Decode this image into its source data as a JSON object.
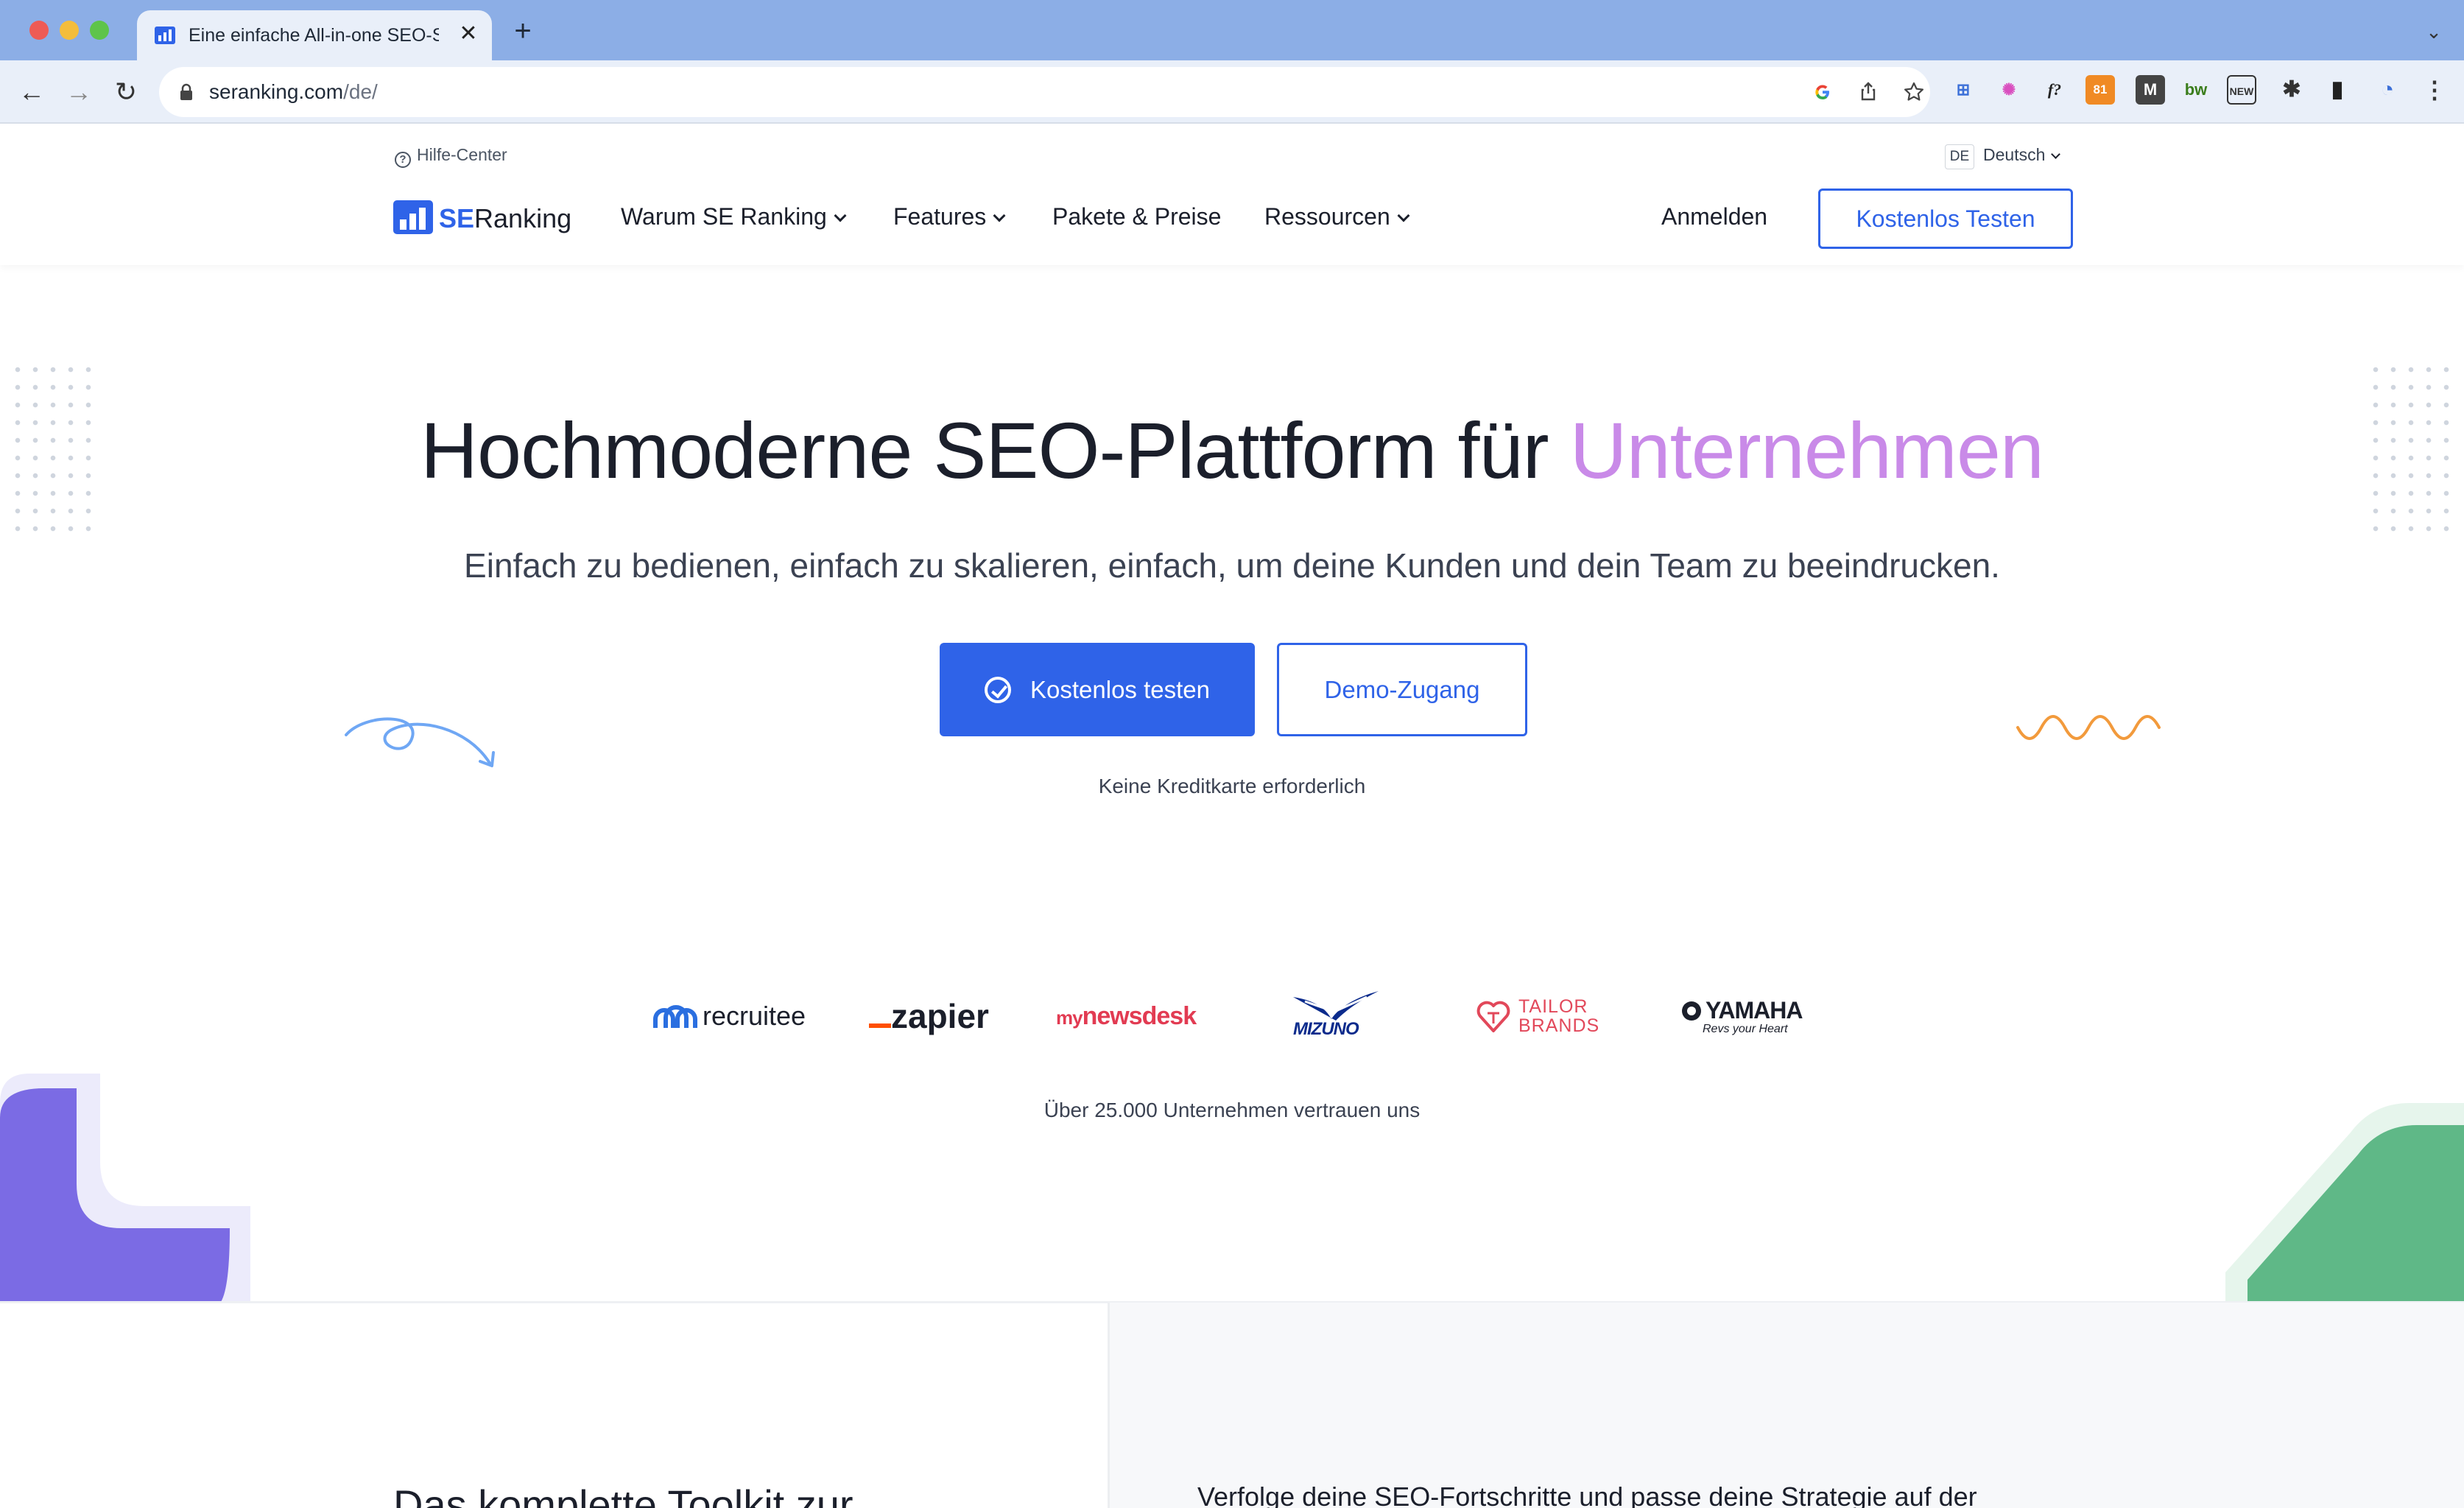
{
  "browser": {
    "tab_title": "Eine einfache All-in-one SEO-Software",
    "tab_close": "✕",
    "new_tab": "+",
    "tab_menu": "⌄",
    "back": "←",
    "forward": "→",
    "reload": "↻",
    "url_host": "seranking.com",
    "url_path": "/de/",
    "omnibox_icons": [
      "google-icon",
      "share-icon",
      "star-icon"
    ],
    "extensions": [
      {
        "name": "ext-translate-icon",
        "label": "⊞",
        "color": "#3b6fd8"
      },
      {
        "name": "ext-color-wheel-icon",
        "label": "✺",
        "color": "#d94fbf"
      },
      {
        "name": "ext-formula-icon",
        "label": "f?",
        "color": "#222222"
      },
      {
        "name": "ext-ahrefs-icon",
        "label": "81",
        "color": "#f08a24"
      },
      {
        "name": "ext-m-icon",
        "label": "M",
        "color": "#333333"
      },
      {
        "name": "ext-bw-icon",
        "label": "bw",
        "color": "#3a7d1c"
      },
      {
        "name": "ext-new-icon",
        "label": "NEW",
        "color": "#333333"
      },
      {
        "name": "extensions-puzzle-icon",
        "label": "✱",
        "color": "#333333"
      },
      {
        "name": "sidepanel-icon",
        "label": "▮",
        "color": "#222222"
      },
      {
        "name": "ext-analytics-icon",
        "label": "◔",
        "color": "#3b6fd8"
      },
      {
        "name": "browser-menu-icon",
        "label": "⋮",
        "color": "#333333"
      }
    ]
  },
  "header": {
    "help": "Hilfe-Center",
    "lang_code": "DE",
    "lang_name": "Deutsch",
    "logo_se": "SE",
    "logo_rest": "Ranking",
    "nav": {
      "why": "Warum SE Ranking",
      "features": "Features",
      "pricing": "Pakete & Preise",
      "resources": "Ressourcen"
    },
    "login": "Anmelden",
    "cta": "Kostenlos Testen"
  },
  "hero": {
    "title_main": "Hochmoderne SEO-Plattform für ",
    "title_accent": "Unternehmen",
    "subtitle": "Einfach zu bedienen, einfach zu skalieren, einfach, um deine Kunden und dein Team zu beeindrucken.",
    "primary_cta": "Kostenlos testen",
    "secondary_cta": "Demo-Zugang",
    "note": "Keine Kreditkarte erforderlich"
  },
  "brands": {
    "recruitee": "recruitee",
    "zapier": "zapier",
    "mynewsdesk_my": "my",
    "mynewsdesk_rest": "newsdesk",
    "mizuno": "MIZUNO",
    "tailor_line1": "TAILOR",
    "tailor_line2": "BRANDS",
    "yamaha": "YAMAHA",
    "yamaha_tag": "Revs your Heart",
    "trust": "Über 25.000 Unternehmen vertrauen uns"
  },
  "colors": {
    "primary": "#2f63e8",
    "accent": "#c98ae8"
  },
  "lower": {
    "left_title": "Das komplette Toolkit zur",
    "right_text": "Verfolge deine SEO-Fortschritte und passe deine Strategie auf der"
  }
}
